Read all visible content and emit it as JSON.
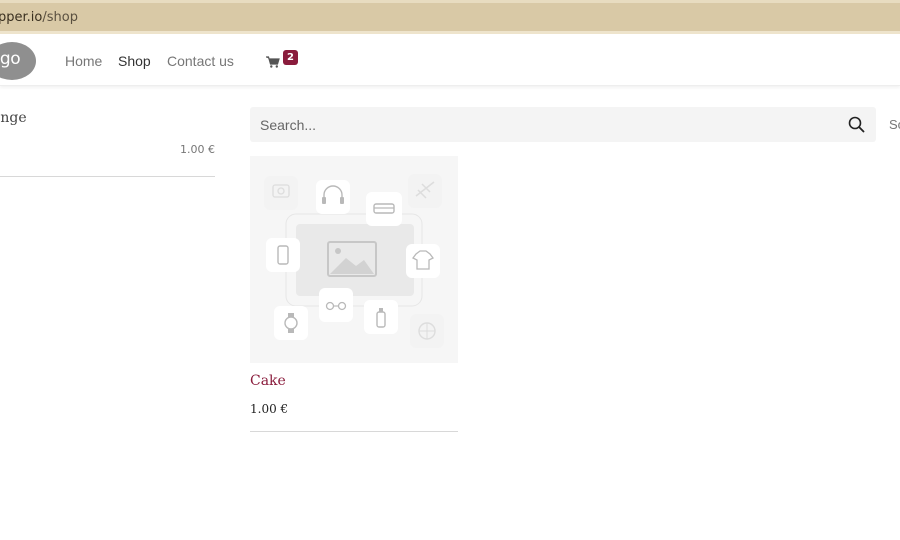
{
  "browser": {
    "url_host": "pper.io",
    "url_path": "/shop"
  },
  "header": {
    "logo_text": "ogo",
    "nav": {
      "home": "Home",
      "shop": "Shop",
      "contact": "Contact us"
    },
    "cart_count": "2",
    "cart_icon": "cart-icon"
  },
  "sidebar": {
    "title": "ange",
    "price": "1.00 €"
  },
  "search": {
    "placeholder": "Search...",
    "icon": "search-icon"
  },
  "sort_label": "So",
  "products": [
    {
      "name": "Cake",
      "price": "1.00 €",
      "image": "placeholder-image"
    }
  ],
  "colors": {
    "accent": "#8a1c3c",
    "urlbar": "#d9c9a6"
  }
}
